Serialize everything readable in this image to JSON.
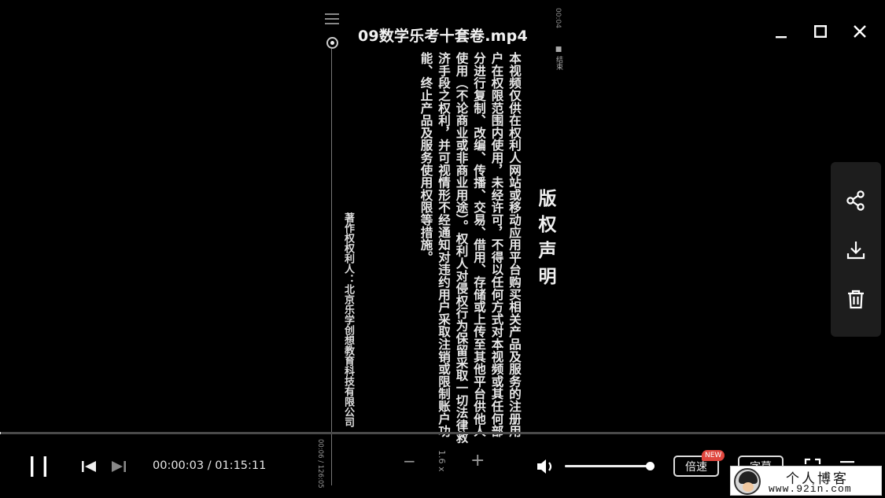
{
  "window": {
    "title": "09数学乐考十套卷.mp4",
    "controls": [
      "minimize",
      "maximize",
      "close"
    ]
  },
  "video_frame": {
    "doc_time_top": "00:04",
    "doc_end_label": "■ 结束",
    "doc_title": "版权声明",
    "doc_body": "本视频仅供在权利人网站或移动应用平台购买相关产品及服务的注册用户在权限范围内使用，未经许可，不得以任何方式对本视频或其任何部分进行复制、改编、传播、交易、借用、存储或上传至其他平台供他人使用（不论商业或非商业用途）。权利人对侵权行为保留采取一切法律救济手段之权利，并可视情形不经通知对违约用户采取注销或限制账户功能、终止产品及服务使用权限等措施。",
    "doc_owner": "著作权权利人：北京乐学创想教育科技有限公司",
    "doc_counter": "00:06 / 126:05",
    "doc_speed": "1.6 x",
    "doc_minus": "−",
    "doc_plus": "+"
  },
  "side_panel": {
    "icons": [
      "share-icon",
      "download-icon",
      "trash-icon"
    ]
  },
  "player": {
    "progress_fraction": 0.0007,
    "current_time": "00:00:03",
    "separator": "/",
    "total_time": "01:15:11",
    "volume_fraction": 1.0,
    "speed_label": "倍速",
    "new_badge": "NEW",
    "subtitle_label": "字幕"
  },
  "watermark": {
    "text_cn": "个人博客",
    "url": "www.92in.com"
  },
  "colors": {
    "background": "#000000",
    "badge": "#e0463e",
    "panel": "#1d1d1d"
  }
}
